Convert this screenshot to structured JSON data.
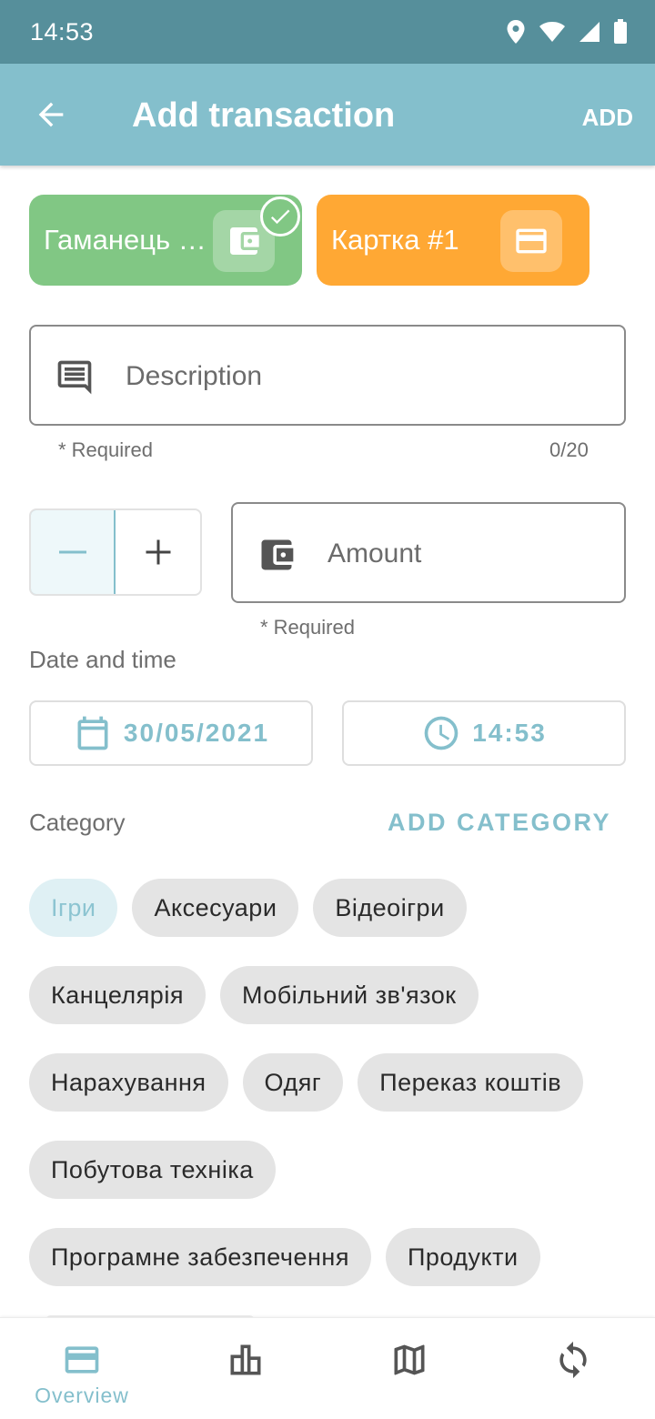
{
  "status_bar": {
    "time": "14:53",
    "icons": [
      "location-icon",
      "wifi-icon",
      "signal-icon",
      "battery-icon"
    ]
  },
  "app_bar": {
    "title": "Add transaction",
    "action_label": "ADD",
    "back_icon": "arrow-back-icon"
  },
  "wallets": [
    {
      "name": "Гаманець …",
      "color": "#81c784",
      "icon": "wallet-icon",
      "selected": true
    },
    {
      "name": "Картка #1",
      "color": "#ffa834",
      "icon": "credit-card-icon",
      "selected": false
    }
  ],
  "description": {
    "placeholder": "Description",
    "helper": "* Required",
    "counter": "0/20",
    "icon": "comment-icon"
  },
  "sign_toggle": {
    "options": [
      "−",
      "+"
    ],
    "selected": "−"
  },
  "amount": {
    "placeholder": "Amount",
    "helper": "* Required",
    "icon": "wallet-icon"
  },
  "date_time": {
    "label": "Date and time",
    "date": "30/05/2021",
    "time": "14:53"
  },
  "category": {
    "label": "Category",
    "add_label": "ADD CATEGORY",
    "chips": [
      "Ігри",
      "Аксесуари",
      "Відеоігри",
      "Канцелярія",
      "Мобільний зв'язок",
      "Нарахування",
      "Одяг",
      "Переказ коштів",
      "Побутова техніка",
      "Програмне забезпечення",
      "Продукти"
    ],
    "selected": "Ігри"
  },
  "bottom_nav": {
    "items": [
      {
        "label": "Overview",
        "icon": "credit-card-icon",
        "active": true
      },
      {
        "label": "",
        "icon": "bar-chart-icon",
        "active": false
      },
      {
        "label": "",
        "icon": "map-icon",
        "active": false
      },
      {
        "label": "",
        "icon": "sync-icon",
        "active": false
      }
    ]
  },
  "colors": {
    "primary": "#84bfcc",
    "status_bar": "#568f9b",
    "wallet_green": "#81c784",
    "wallet_orange": "#ffa834"
  }
}
